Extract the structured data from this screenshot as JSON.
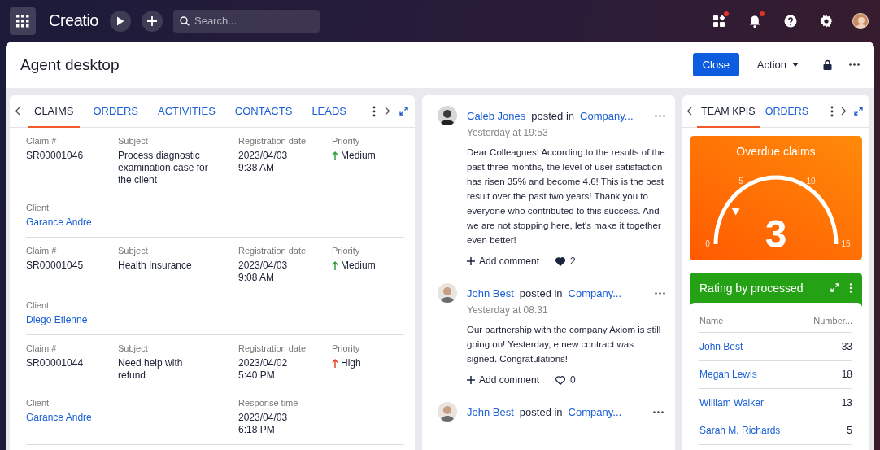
{
  "topbar": {
    "logo": "Creatio",
    "search": {
      "placeholder": "Search..."
    },
    "icons": [
      {
        "kind": "apps",
        "badge": true
      },
      {
        "kind": "bell",
        "badge": true
      },
      {
        "kind": "help",
        "badge": false
      },
      {
        "kind": "settings",
        "badge": false
      }
    ]
  },
  "page": {
    "title": "Agent desktop",
    "close_button": "Close",
    "action_button": "Action"
  },
  "claims_panel": {
    "tabs": [
      {
        "label": "CLAIMS",
        "selected": true
      },
      {
        "label": "ORDERS",
        "selected": false
      },
      {
        "label": "ACTIVITIES",
        "selected": false
      },
      {
        "label": "CONTACTS",
        "selected": false
      },
      {
        "label": "LEADS",
        "selected": false
      }
    ],
    "records": [
      {
        "claim": {
          "label": "Claim #",
          "value": "SR00001046"
        },
        "subject": {
          "label": "Subject",
          "value": "Process diagnostic examination case for the client"
        },
        "registration_date": {
          "label": "Registration date",
          "value": "2023/04/03 9:38 AM"
        },
        "priority": {
          "label": "Priority",
          "value": "Medium",
          "color": "#2e9e3e"
        },
        "client": {
          "label": "Client",
          "value": "Garance Andre"
        }
      },
      {
        "claim": {
          "label": "Claim #",
          "value": "SR00001045"
        },
        "subject": {
          "label": "Subject",
          "value": "Health Insurance"
        },
        "registration_date": {
          "label": "Registration date",
          "value": "2023/04/03 9:08 AM"
        },
        "priority": {
          "label": "Priority",
          "value": "Medium",
          "color": "#2e9e3e"
        },
        "client": {
          "label": "Client",
          "value": "Diego Etienne"
        }
      },
      {
        "claim": {
          "label": "Claim #",
          "value": "SR00001044"
        },
        "subject": {
          "label": "Subject",
          "value": "Need help with refund"
        },
        "registration_date": {
          "label": "Registration date",
          "value": "2023/04/02 5:40 PM"
        },
        "priority": {
          "label": "Priority",
          "value": "High",
          "color": "#e8472b"
        },
        "client": {
          "label": "Client",
          "value": "Garance Andre"
        },
        "response_time": {
          "label": "Response time",
          "value": "2023/04/03 6:18 PM"
        }
      }
    ]
  },
  "feed": {
    "posts": [
      {
        "author": "Caleb Jones",
        "posted_in": "posted in",
        "channel": "Company...",
        "time": "Yesterday at 19:53",
        "body": "Dear Colleagues! According to the results of the past three months, the level of user satisfaction has risen 35% and become 4.6! This is the best result over the past two years! Thank you to everyone who contributed to this success. And we are not stopping here, let's make it together even better!",
        "add_comment": "Add comment",
        "liked": true,
        "likes": "2"
      },
      {
        "author": "John Best",
        "posted_in": "posted in",
        "channel": "Company...",
        "time": "Yesterday at 08:31",
        "body": "Our partnership with the company Axiom is still going on! Yesterday, e new contract was signed. Congratulations!",
        "add_comment": "Add comment",
        "liked": false,
        "likes": "0"
      },
      {
        "author": "John Best",
        "posted_in": "posted in",
        "channel": "Company..."
      }
    ]
  },
  "kpi_panel": {
    "tabs": [
      {
        "label": "TEAM KPIS",
        "selected": true
      },
      {
        "label": "ORDERS",
        "selected": false
      }
    ],
    "gauge": {
      "title": "Overdue claims",
      "value": "3",
      "level": 0.2,
      "ticks": [
        "0",
        "5",
        "10",
        "15"
      ]
    },
    "rating": {
      "title": "Rating by processed",
      "columns": [
        "Name",
        "Number..."
      ],
      "rows": [
        {
          "name": "John Best",
          "value": "33"
        },
        {
          "name": "Megan Lewis",
          "value": "18"
        },
        {
          "name": "William Walker",
          "value": "13"
        },
        {
          "name": "Sarah M. Richards",
          "value": "5"
        }
      ]
    }
  }
}
